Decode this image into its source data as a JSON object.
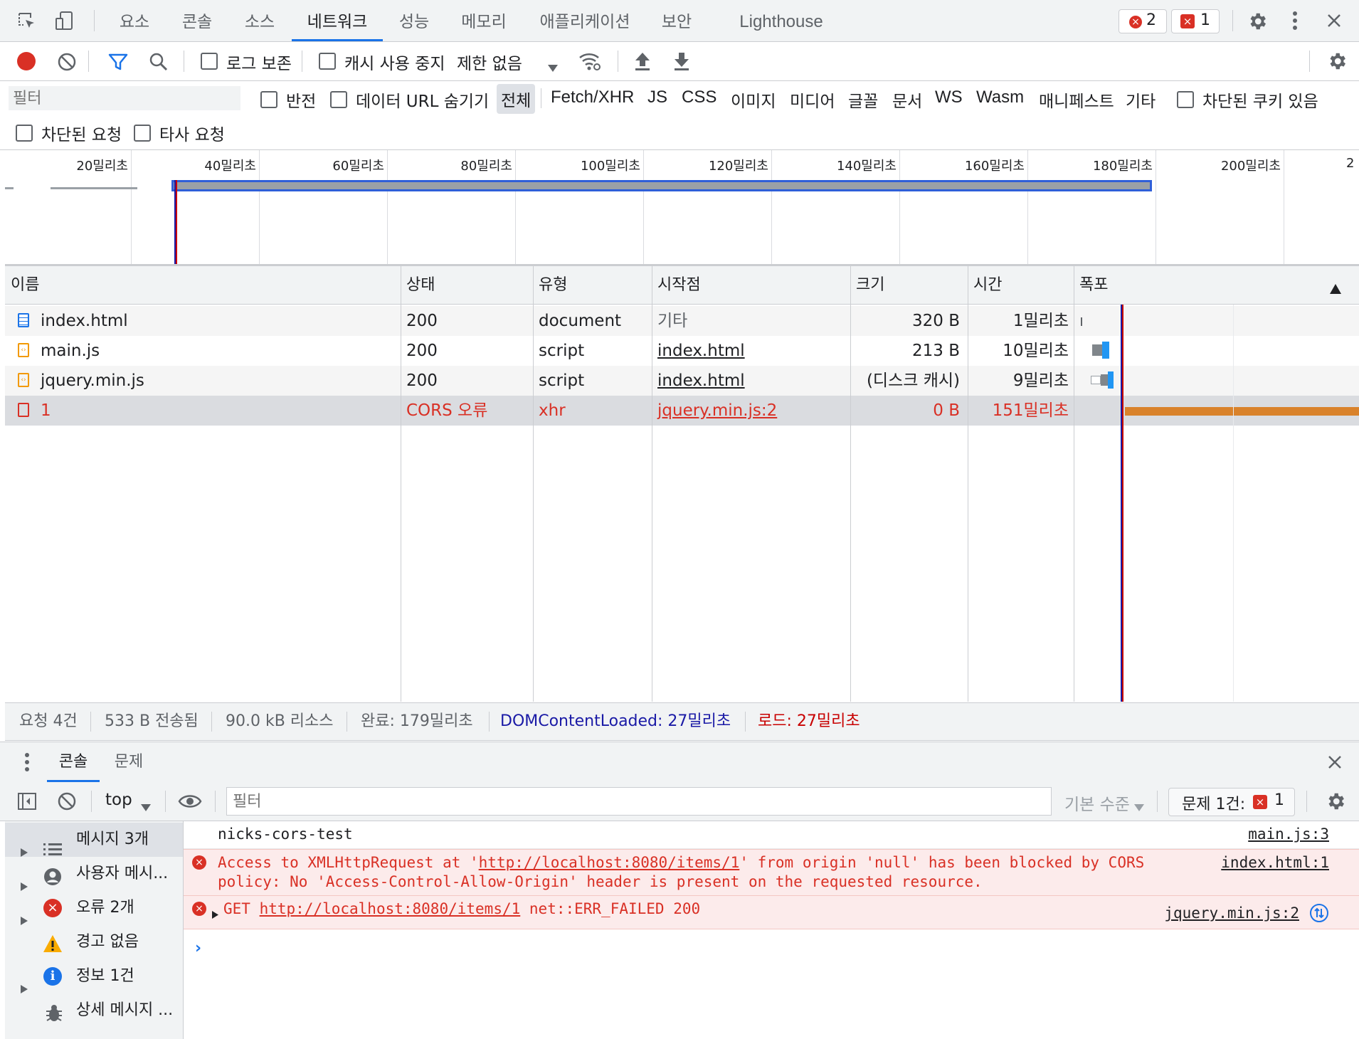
{
  "tabs": {
    "elements": "요소",
    "console": "콘솔",
    "sources": "소스",
    "network": "네트워크",
    "performance": "성능",
    "memory": "메모리",
    "application": "애플리케이션",
    "security": "보안",
    "lighthouse": "Lighthouse"
  },
  "badges": {
    "errors": "2",
    "issues": "1"
  },
  "toolbar": {
    "preserve_log": "로그 보존",
    "disable_cache": "캐시 사용 중지",
    "throttling": "제한 없음"
  },
  "filter": {
    "placeholder": "필터",
    "invert": "반전",
    "hide_data_urls": "데이터 URL 숨기기",
    "types": [
      "전체",
      "Fetch/XHR",
      "JS",
      "CSS",
      "이미지",
      "미디어",
      "글꼴",
      "문서",
      "WS",
      "Wasm",
      "매니페스트",
      "기타"
    ],
    "blocked_cookies": "차단된 쿠키 있음",
    "blocked_requests": "차단된 요청",
    "third_party": "타사 요청"
  },
  "overview": {
    "ticks": [
      "20밀리초",
      "40밀리초",
      "60밀리초",
      "80밀리초",
      "100밀리초",
      "120밀리초",
      "140밀리초",
      "160밀리초",
      "180밀리초",
      "200밀리초",
      "2"
    ]
  },
  "table": {
    "headers": {
      "name": "이름",
      "status": "상태",
      "type": "유형",
      "initiator": "시작점",
      "size": "크기",
      "time": "시간",
      "waterfall": "폭포"
    },
    "rows": [
      {
        "name": "index.html",
        "status": "200",
        "type": "document",
        "initiator": "기타",
        "size": "320 B",
        "time": "1밀리초",
        "icon": "document-icon"
      },
      {
        "name": "main.js",
        "status": "200",
        "type": "script",
        "initiator": "index.html",
        "size": "213 B",
        "time": "10밀리초",
        "icon": "script-icon"
      },
      {
        "name": "jquery.min.js",
        "status": "200",
        "type": "script",
        "initiator": "index.html",
        "size": "(디스크 캐시)",
        "time": "9밀리초",
        "icon": "script-icon"
      },
      {
        "name": "1",
        "status": "CORS 오류",
        "type": "xhr",
        "initiator": "jquery.min.js:2",
        "size": "0 B",
        "time": "151밀리초",
        "icon": "error-request-icon"
      }
    ]
  },
  "summary": {
    "requests": "요청 4건",
    "transferred": "533 B 전송됨",
    "resources": "90.0 kB 리소스",
    "finish": "완료: 179밀리초",
    "dcl": "DOMContentLoaded: 27밀리초",
    "load": "로드: 27밀리초"
  },
  "drawer": {
    "tabs": {
      "console": "콘솔",
      "issues": "문제"
    },
    "context": "top",
    "filter_placeholder": "필터",
    "levels": "기본 수준",
    "issues_count": "문제 1건:",
    "issues_badge": "1"
  },
  "sidebar": {
    "items": [
      "메시지 3개",
      "사용자 메시...",
      "오류 2개",
      "경고 없음",
      "정보 1건",
      "상세 메시지 ..."
    ]
  },
  "console": {
    "log": {
      "text": "nicks-cors-test",
      "source": "main.js:3"
    },
    "error1": {
      "prefix": "Access to XMLHttpRequest at '",
      "url": "http://localhost:8080/items/1",
      "suffix": "' from origin 'null' has been blocked by CORS",
      "line2": "policy: No 'Access-Control-Allow-Origin' header is present on the requested resource.",
      "source": "index.html:1"
    },
    "error2": {
      "method": "GET",
      "url": "http://localhost:8080/items/1",
      "rest": "net::ERR_FAILED 200",
      "source": "jquery.min.js:2"
    }
  },
  "colors": {
    "accent": "#1a73e8",
    "error": "#d93025",
    "record": "#d93025",
    "waterfall_error": "#d9822b",
    "dcl_line": "#1a1aa6",
    "load_line": "#c80000"
  }
}
